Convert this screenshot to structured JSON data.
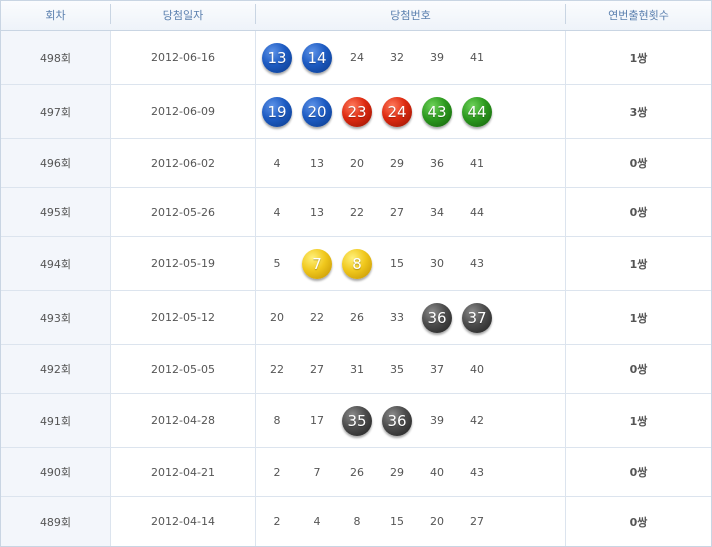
{
  "header": {
    "round": "회차",
    "date": "당첨일자",
    "numbers": "당첨번호",
    "consecutive": "연번출현횟수"
  },
  "colors": {
    "blue": "#1d5bc2",
    "red": "#dd2a10",
    "green": "#2d9a1f",
    "yellow": "#f0c81d",
    "gray": "#4c4c4c",
    "header_text": "#5a7fae"
  },
  "rows": [
    {
      "round": "498회",
      "date": "2012-06-16",
      "numbers": [
        {
          "v": "13",
          "ball": "blue"
        },
        {
          "v": "14",
          "ball": "blue"
        },
        {
          "v": "24",
          "ball": ""
        },
        {
          "v": "32",
          "ball": ""
        },
        {
          "v": "39",
          "ball": ""
        },
        {
          "v": "41",
          "ball": ""
        }
      ],
      "consecutive": "1쌍"
    },
    {
      "round": "497회",
      "date": "2012-06-09",
      "numbers": [
        {
          "v": "19",
          "ball": "blue"
        },
        {
          "v": "20",
          "ball": "blue"
        },
        {
          "v": "23",
          "ball": "red"
        },
        {
          "v": "24",
          "ball": "red"
        },
        {
          "v": "43",
          "ball": "green"
        },
        {
          "v": "44",
          "ball": "green"
        }
      ],
      "consecutive": "3쌍"
    },
    {
      "round": "496회",
      "date": "2012-06-02",
      "numbers": [
        {
          "v": "4",
          "ball": ""
        },
        {
          "v": "13",
          "ball": ""
        },
        {
          "v": "20",
          "ball": ""
        },
        {
          "v": "29",
          "ball": ""
        },
        {
          "v": "36",
          "ball": ""
        },
        {
          "v": "41",
          "ball": ""
        }
      ],
      "consecutive": "0쌍"
    },
    {
      "round": "495회",
      "date": "2012-05-26",
      "numbers": [
        {
          "v": "4",
          "ball": ""
        },
        {
          "v": "13",
          "ball": ""
        },
        {
          "v": "22",
          "ball": ""
        },
        {
          "v": "27",
          "ball": ""
        },
        {
          "v": "34",
          "ball": ""
        },
        {
          "v": "44",
          "ball": ""
        }
      ],
      "consecutive": "0쌍"
    },
    {
      "round": "494회",
      "date": "2012-05-19",
      "numbers": [
        {
          "v": "5",
          "ball": ""
        },
        {
          "v": "7",
          "ball": "yellow"
        },
        {
          "v": "8",
          "ball": "yellow"
        },
        {
          "v": "15",
          "ball": ""
        },
        {
          "v": "30",
          "ball": ""
        },
        {
          "v": "43",
          "ball": ""
        }
      ],
      "consecutive": "1쌍"
    },
    {
      "round": "493회",
      "date": "2012-05-12",
      "numbers": [
        {
          "v": "20",
          "ball": ""
        },
        {
          "v": "22",
          "ball": ""
        },
        {
          "v": "26",
          "ball": ""
        },
        {
          "v": "33",
          "ball": ""
        },
        {
          "v": "36",
          "ball": "gray"
        },
        {
          "v": "37",
          "ball": "gray"
        }
      ],
      "consecutive": "1쌍"
    },
    {
      "round": "492회",
      "date": "2012-05-05",
      "numbers": [
        {
          "v": "22",
          "ball": ""
        },
        {
          "v": "27",
          "ball": ""
        },
        {
          "v": "31",
          "ball": ""
        },
        {
          "v": "35",
          "ball": ""
        },
        {
          "v": "37",
          "ball": ""
        },
        {
          "v": "40",
          "ball": ""
        }
      ],
      "consecutive": "0쌍"
    },
    {
      "round": "491회",
      "date": "2012-04-28",
      "numbers": [
        {
          "v": "8",
          "ball": ""
        },
        {
          "v": "17",
          "ball": ""
        },
        {
          "v": "35",
          "ball": "gray"
        },
        {
          "v": "36",
          "ball": "gray"
        },
        {
          "v": "39",
          "ball": ""
        },
        {
          "v": "42",
          "ball": ""
        }
      ],
      "consecutive": "1쌍"
    },
    {
      "round": "490회",
      "date": "2012-04-21",
      "numbers": [
        {
          "v": "2",
          "ball": ""
        },
        {
          "v": "7",
          "ball": ""
        },
        {
          "v": "26",
          "ball": ""
        },
        {
          "v": "29",
          "ball": ""
        },
        {
          "v": "40",
          "ball": ""
        },
        {
          "v": "43",
          "ball": ""
        }
      ],
      "consecutive": "0쌍"
    },
    {
      "round": "489회",
      "date": "2012-04-14",
      "numbers": [
        {
          "v": "2",
          "ball": ""
        },
        {
          "v": "4",
          "ball": ""
        },
        {
          "v": "8",
          "ball": ""
        },
        {
          "v": "15",
          "ball": ""
        },
        {
          "v": "20",
          "ball": ""
        },
        {
          "v": "27",
          "ball": ""
        }
      ],
      "consecutive": "0쌍"
    }
  ]
}
